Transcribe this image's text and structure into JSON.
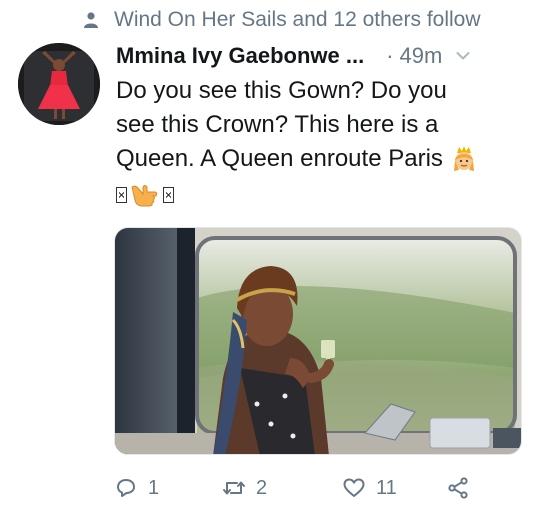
{
  "social_context": {
    "text": "Wind On Her Sails and 12 others follow",
    "icon": "person-icon"
  },
  "tweet": {
    "display_name": "Mmina Ivy Gaebonwe ...",
    "separator": "·",
    "timestamp": "49m",
    "text_lines": [
      "Do you see this Gown? Do you",
      "see this Crown? This here is a",
      "Queen. A Queen enroute Paris"
    ],
    "emojis": [
      "princess-emoji",
      "missing-glyph",
      "pointing-hand-emoji",
      "missing-glyph"
    ]
  },
  "actions": {
    "reply_count": "1",
    "retweet_count": "2",
    "like_count": "11"
  },
  "colors": {
    "secondary_text": "#657786",
    "primary_text": "#14171a",
    "background": "#ffffff"
  }
}
